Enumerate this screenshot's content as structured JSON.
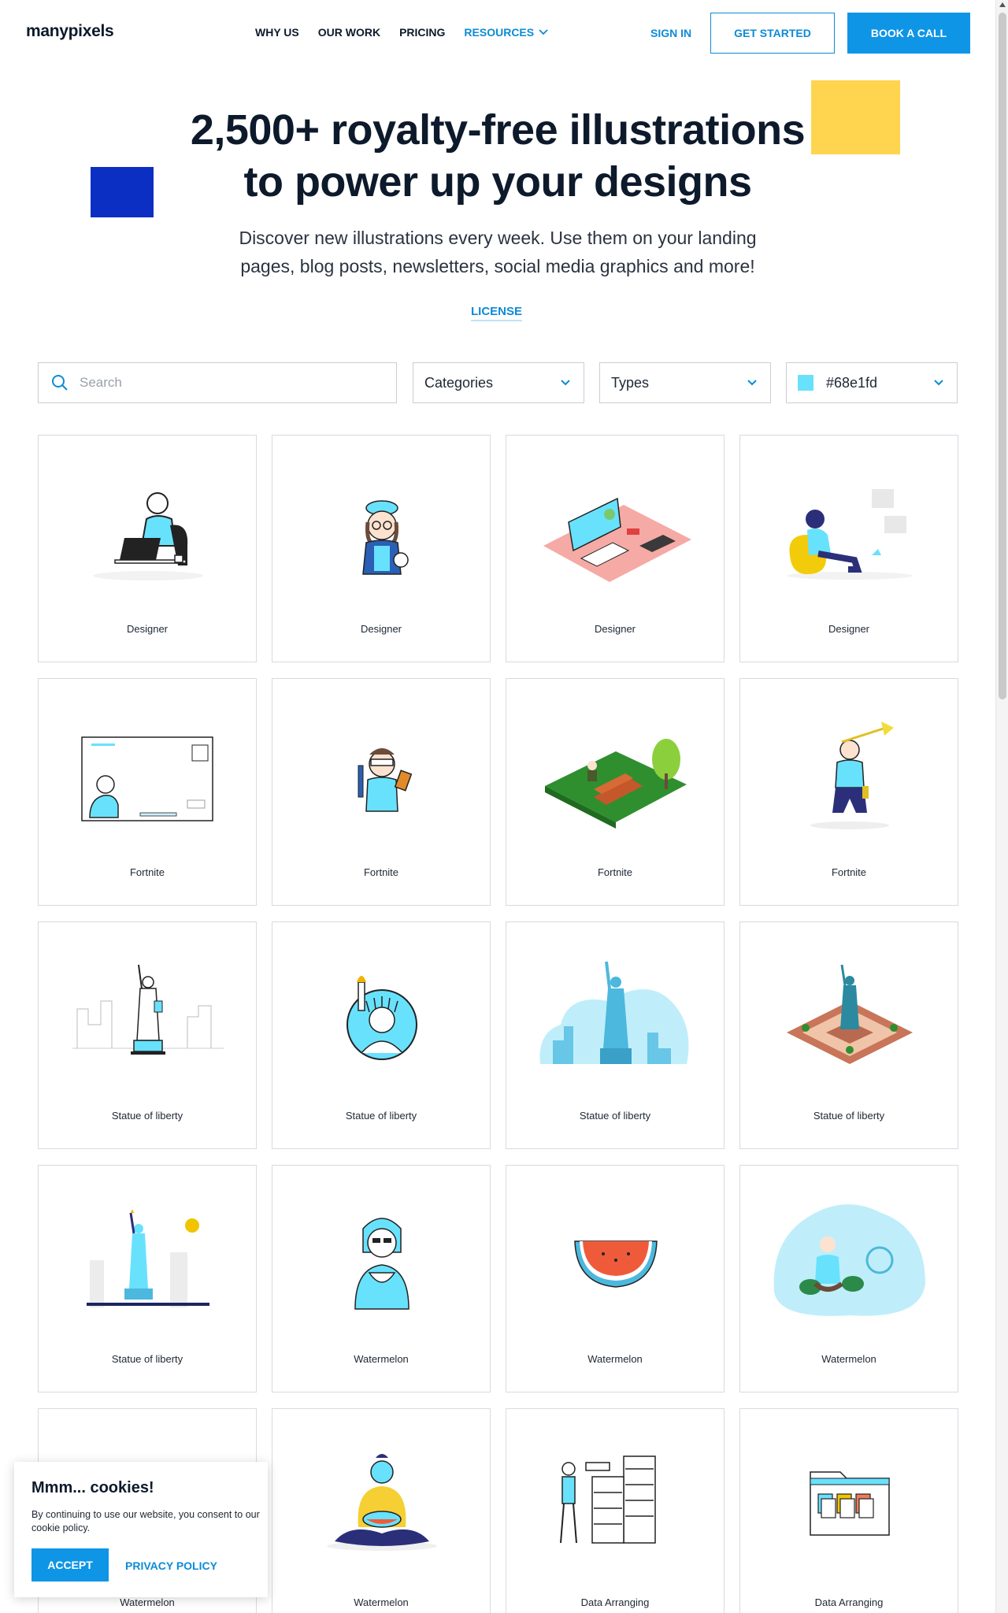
{
  "header": {
    "logo": "manypixels",
    "nav": [
      "WHY US",
      "OUR WORK",
      "PRICING"
    ],
    "resources_label": "RESOURCES",
    "sign_in": "SIGN IN",
    "get_started": "GET STARTED",
    "book_call": "BOOK A CALL"
  },
  "hero": {
    "title_line1": "2,500+ royalty-free illustrations",
    "title_line2": "to power up your designs",
    "subtitle_line1": "Discover new illustrations every week. Use them on your landing",
    "subtitle_line2": "pages, blog posts, newsletters, social media graphics and more!",
    "license": "LICENSE"
  },
  "filters": {
    "search_placeholder": "Search",
    "categories": "Categories",
    "types": "Types",
    "color_value": "#68e1fd",
    "color_swatch": "#68e1fd"
  },
  "illustrations": [
    {
      "label": "Designer"
    },
    {
      "label": "Designer"
    },
    {
      "label": "Designer"
    },
    {
      "label": "Designer"
    },
    {
      "label": "Fortnite"
    },
    {
      "label": "Fortnite"
    },
    {
      "label": "Fortnite"
    },
    {
      "label": "Fortnite"
    },
    {
      "label": "Statue of liberty"
    },
    {
      "label": "Statue of liberty"
    },
    {
      "label": "Statue of liberty"
    },
    {
      "label": "Statue of liberty"
    },
    {
      "label": "Statue of liberty"
    },
    {
      "label": "Watermelon"
    },
    {
      "label": "Watermelon"
    },
    {
      "label": "Watermelon"
    },
    {
      "label": "Watermelon"
    },
    {
      "label": "Watermelon"
    },
    {
      "label": "Data Arranging"
    },
    {
      "label": "Data Arranging"
    }
  ],
  "cookie": {
    "title": "Mmm... cookies!",
    "text": "By continuing to use our website, you consent to our cookie policy.",
    "accept": "ACCEPT",
    "privacy": "PRIVACY POLICY"
  },
  "colors": {
    "accent": "#0e95e6",
    "illustration_blue": "#68e1fd",
    "deco_yellow": "#ffd54f",
    "deco_blue": "#0b2fc2"
  }
}
